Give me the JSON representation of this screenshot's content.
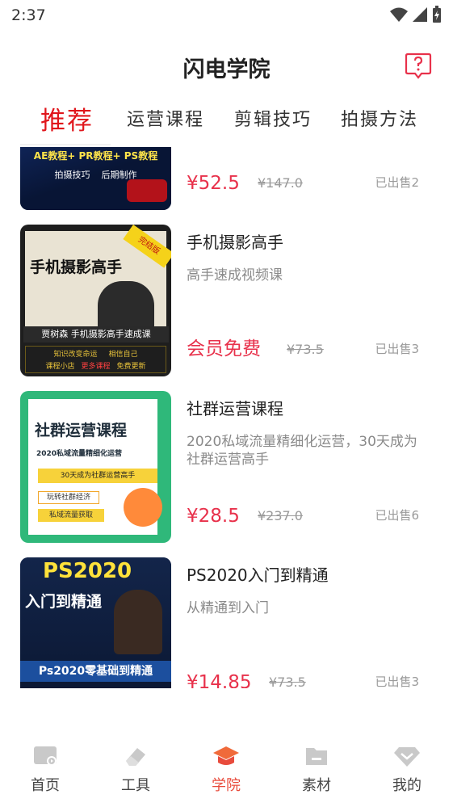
{
  "status_bar": {
    "time": "2:37"
  },
  "header": {
    "title": "闪电学院",
    "help_icon": "help-question-icon"
  },
  "tabs": [
    {
      "label": "推荐",
      "active": true
    },
    {
      "label": "运营课程",
      "active": false
    },
    {
      "label": "剪辑技巧",
      "active": false
    },
    {
      "label": "拍摄方法",
      "active": false
    }
  ],
  "courses": [
    {
      "title": "",
      "subtitle": "",
      "price": "¥52.5",
      "original_price": "¥147.0",
      "sold": "已出售2",
      "thumb_text": [
        "AE教程+ PR教程+ PS教程",
        "拍摄技巧",
        "后期制作"
      ]
    },
    {
      "title": "手机摄影高手",
      "subtitle": "高手速成视频课",
      "price": "会员免费",
      "original_price": "¥73.5",
      "sold": "已出售3",
      "thumb_text": [
        "完结版",
        "手机摄影高手",
        "贾树森 手机摄影高手速成课",
        "知识改变命运",
        "相信自己",
        "课程小店",
        "更多课程",
        "免费更新"
      ]
    },
    {
      "title": "社群运营课程",
      "subtitle": "2020私域流量精细化运营，30天成为社群运营高手",
      "price": "¥28.5",
      "original_price": "¥237.0",
      "sold": "已出售6",
      "thumb_text": [
        "社群运营课程",
        "2020私域流量精细化运营",
        "30天成为社群运营高手",
        "玩转社群经济",
        "私域流量获取"
      ]
    },
    {
      "title": "PS2020入门到精通",
      "subtitle": "从精通到入门",
      "price": "¥14.85",
      "original_price": "¥73.5",
      "sold": "已出售3",
      "thumb_text": [
        "PS2020",
        "入门到精通",
        "Ps2020零基础到精通"
      ]
    }
  ],
  "tabbar": [
    {
      "label": "首页",
      "icon": "home-icon",
      "active": false
    },
    {
      "label": "工具",
      "icon": "eraser-icon",
      "active": false
    },
    {
      "label": "学院",
      "icon": "graduation-cap-icon",
      "active": true
    },
    {
      "label": "素材",
      "icon": "folder-icon",
      "active": false
    },
    {
      "label": "我的",
      "icon": "diamond-icon",
      "active": false
    }
  ],
  "colors": {
    "accent": "#e0151b",
    "price": "#e8314b",
    "tab_active": "#e84b3c"
  }
}
